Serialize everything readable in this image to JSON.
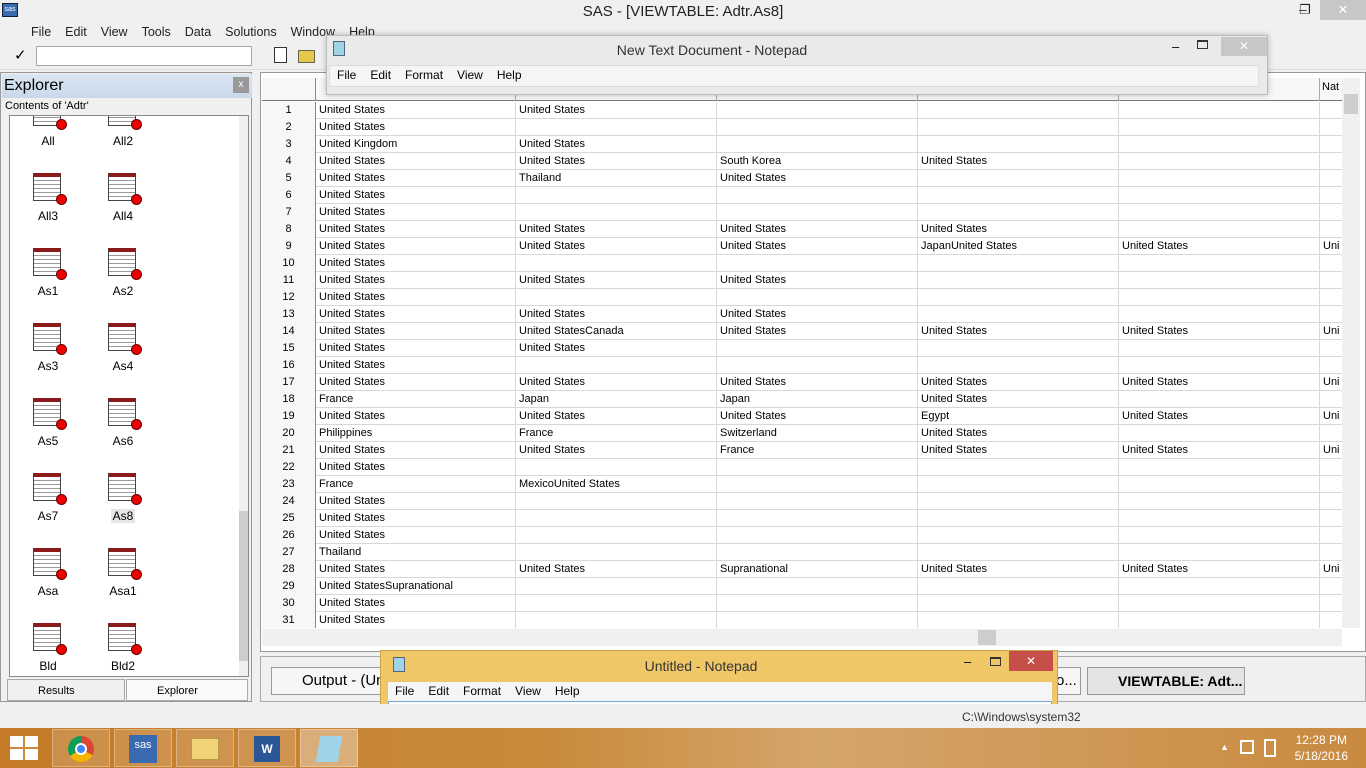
{
  "app": {
    "title": "SAS - [VIEWTABLE: Adtr.As8]",
    "minimize": "–",
    "restore": "❐",
    "close": "✕"
  },
  "menu": [
    "File",
    "Edit",
    "View",
    "Tools",
    "Data",
    "Solutions",
    "Window",
    "Help"
  ],
  "toolbar": {
    "check": "✓",
    "command_value": ""
  },
  "explorer": {
    "title": "Explorer",
    "close": "x",
    "contents_label": "Contents of 'Adtr'",
    "items": [
      "All",
      "All2",
      "All3",
      "All4",
      "As1",
      "As2",
      "As3",
      "As4",
      "As5",
      "As6",
      "As7",
      "As8",
      "Asa",
      "Asa1",
      "Bld",
      "Bld2"
    ],
    "tabs": [
      "Results",
      "Explorer"
    ]
  },
  "table": {
    "last_header": "Nat",
    "rows": [
      [
        "1",
        "United States",
        "United States",
        "",
        "",
        "",
        ""
      ],
      [
        "2",
        "United States",
        "",
        "",
        "",
        "",
        ""
      ],
      [
        "3",
        "United Kingdom",
        "United States",
        "",
        "",
        "",
        ""
      ],
      [
        "4",
        "United States",
        "United States",
        "South Korea",
        "United States",
        "",
        ""
      ],
      [
        "5",
        "United States",
        "Thailand",
        "United States",
        "",
        "",
        ""
      ],
      [
        "6",
        "United States",
        "",
        "",
        "",
        "",
        ""
      ],
      [
        "7",
        "United States",
        "",
        "",
        "",
        "",
        ""
      ],
      [
        "8",
        "United States",
        "United States",
        "United States",
        "United States",
        "",
        ""
      ],
      [
        "9",
        "United States",
        "United States",
        "United States",
        "JapanUnited States",
        "United States",
        "Uni"
      ],
      [
        "10",
        "United States",
        "",
        "",
        "",
        "",
        ""
      ],
      [
        "11",
        "United States",
        "United States",
        "United States",
        "",
        "",
        ""
      ],
      [
        "12",
        "United States",
        "",
        "",
        "",
        "",
        ""
      ],
      [
        "13",
        "United States",
        "United States",
        "United States",
        "",
        "",
        ""
      ],
      [
        "14",
        "United States",
        "United StatesCanada",
        "United States",
        "United States",
        "United States",
        "Uni"
      ],
      [
        "15",
        "United States",
        "United States",
        "",
        "",
        "",
        ""
      ],
      [
        "16",
        "United States",
        "",
        "",
        "",
        "",
        ""
      ],
      [
        "17",
        "United States",
        "United States",
        "United States",
        "United States",
        "United States",
        "Uni"
      ],
      [
        "18",
        "France",
        "Japan",
        "Japan",
        "United States",
        "",
        ""
      ],
      [
        "19",
        "United States",
        "United States",
        "United States",
        "Egypt",
        "United States",
        "Uni"
      ],
      [
        "20",
        "Philippines",
        "France",
        "Switzerland",
        "United States",
        "",
        ""
      ],
      [
        "21",
        "United States",
        "United States",
        "France",
        "United States",
        "United States",
        "Uni"
      ],
      [
        "22",
        "United States",
        "",
        "",
        "",
        "",
        ""
      ],
      [
        "23",
        "France",
        "MexicoUnited States",
        "",
        "",
        "",
        ""
      ],
      [
        "24",
        "United States",
        "",
        "",
        "",
        "",
        ""
      ],
      [
        "25",
        "United States",
        "",
        "",
        "",
        "",
        ""
      ],
      [
        "26",
        "United States",
        "",
        "",
        "",
        "",
        ""
      ],
      [
        "27",
        "Thailand",
        "",
        "",
        "",
        "",
        ""
      ],
      [
        "28",
        "United States",
        "United States",
        "Supranational",
        "United States",
        "United States",
        "Uni"
      ],
      [
        "29",
        "United StatesSupranational",
        "",
        "",
        "",
        "",
        ""
      ],
      [
        "30",
        "United States",
        "",
        "",
        "",
        "",
        ""
      ],
      [
        "31",
        "United States",
        "",
        "",
        "",
        "",
        ""
      ]
    ]
  },
  "notepad1": {
    "title": "New Text Document - Notepad",
    "menu": [
      "File",
      "Edit",
      "Format",
      "View",
      "Help"
    ]
  },
  "notepad2": {
    "title": "Untitled - Notepad",
    "menu": [
      "File",
      "Edit",
      "Format",
      "View",
      "Help"
    ]
  },
  "window_tabs": {
    "output": "Output - (Unt",
    "middle": "o...",
    "viewtable": "VIEWTABLE: Adt..."
  },
  "status": {
    "path": "C:\\Windows\\system32"
  },
  "clock": {
    "time": "12:28 PM",
    "date": "5/18/2016"
  }
}
